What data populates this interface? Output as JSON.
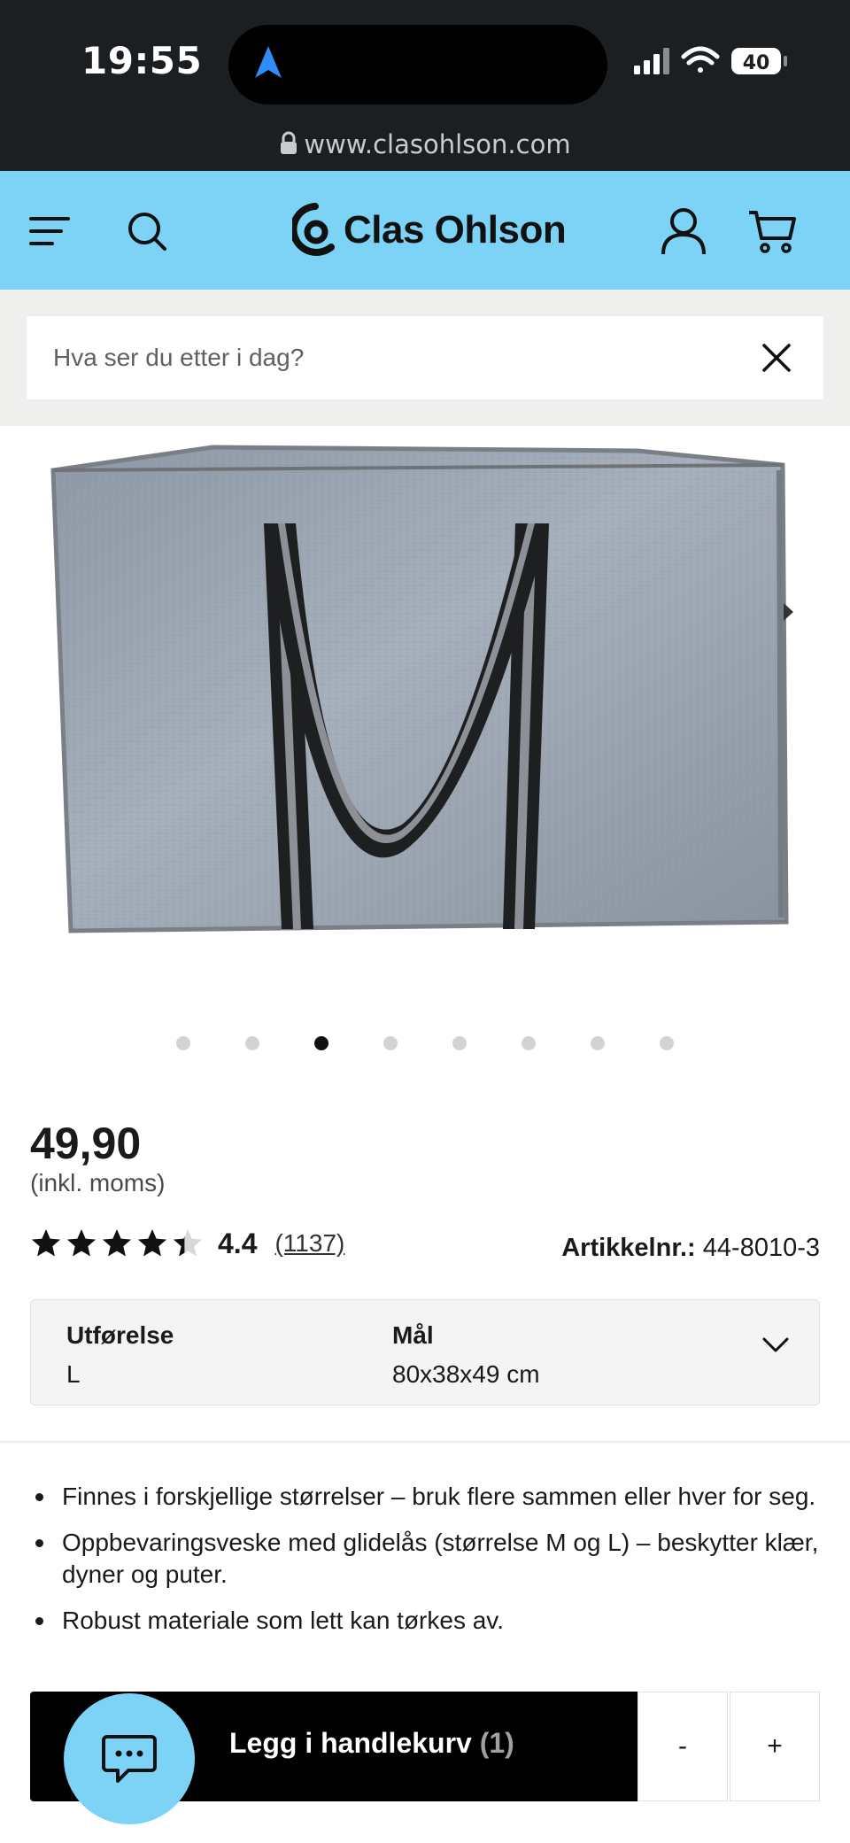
{
  "status_bar": {
    "time": "19:55",
    "battery": "40",
    "url": "www.clasohlson.com"
  },
  "header": {
    "brand": "Clas Ohlson",
    "brand_color": "#7dd3f5"
  },
  "search": {
    "placeholder": "Hva ser du etter i dag?"
  },
  "gallery": {
    "dot_count": 8,
    "active_index": 2
  },
  "product": {
    "price": "49,90",
    "vat_note": "(inkl. moms)",
    "rating": "4.4",
    "rating_fraction": 0.88,
    "review_count": "(1137)",
    "article_label": "Artikkelnr.:",
    "article_number": "44-8010-3",
    "variant": {
      "label1": "Utførelse",
      "value1": "L",
      "label2": "Mål",
      "value2": "80x38x49 cm"
    },
    "features": [
      "Finnes i forskjellige størrelser – bruk flere sammen eller hver for seg.",
      "Oppbevaringsveske med glidelås (størrelse M og L) – beskytter klær, dyner og puter.",
      "Robust materiale som lett kan tørkes av."
    ]
  },
  "cart_bar": {
    "add_label": "Legg i handlekurv",
    "count": "(1)",
    "minus": "-",
    "plus": "+"
  }
}
